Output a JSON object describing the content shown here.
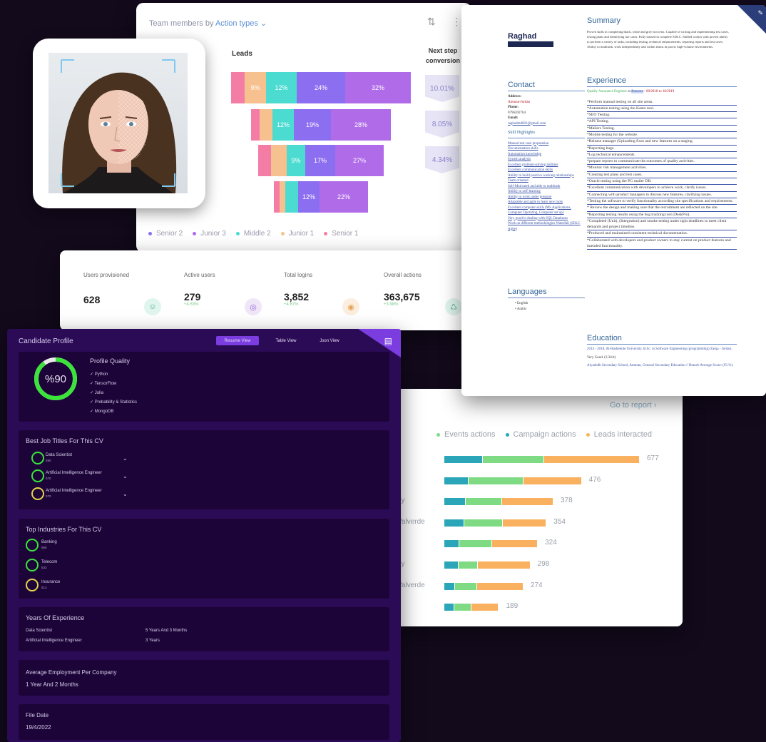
{
  "funnel": {
    "title": "Team members by",
    "title_action": "Action types",
    "leads_label": "Leads",
    "next_step_label": "Next step conversion",
    "rows": [
      {
        "segments": [
          "",
          "9%",
          "12%",
          "24%",
          "32%"
        ]
      },
      {
        "segments": [
          "",
          "",
          "12%",
          "19%",
          "28%"
        ]
      },
      {
        "segments": [
          "",
          "",
          "9%",
          "17%",
          "27%"
        ]
      },
      {
        "segments": [
          "",
          "",
          "",
          "12%",
          "22%"
        ]
      }
    ],
    "conversions": [
      "10.01%",
      "8.05%",
      "4.34%"
    ],
    "legend": [
      "Senior 2",
      "Junior 3",
      "Middle 2",
      "Junior 1",
      "Senior 1"
    ],
    "colors": {
      "senior2": "#8c6ef0",
      "junior3": "#b06be8",
      "middle2": "#4cdbd0",
      "junior1": "#f6c18f",
      "senior1": "#f47da6"
    }
  },
  "stats": {
    "items": [
      {
        "label": "Users provisioned",
        "value": "628",
        "pct": ""
      },
      {
        "label": "Active users",
        "value": "279",
        "pct": "+4.63%"
      },
      {
        "label": "Total logins",
        "value": "3,852",
        "pct": "+4.67%"
      },
      {
        "label": "Overall actions",
        "value": "363,675",
        "pct": "+3.98%"
      }
    ]
  },
  "bars": {
    "goto": "Go to report",
    "legend": [
      "Events actions",
      "Campaign actions",
      "Leads interacted"
    ],
    "colors": {
      "events": "#2aa6b8",
      "campaign": "#7fda84",
      "leads": "#f9b160"
    },
    "names": [
      "",
      "",
      "ey",
      "Valverde",
      "",
      "ey",
      "Valverde",
      ""
    ],
    "rows": [
      {
        "total": 677,
        "events": 54,
        "campaign": 86,
        "leads": 134
      },
      {
        "total": 476,
        "events": 42,
        "campaign": 94,
        "leads": 99
      },
      {
        "total": 378,
        "events": 40,
        "campaign": 68,
        "leads": 96
      },
      {
        "total": 354,
        "events": 35,
        "campaign": 66,
        "leads": 75
      },
      {
        "total": 324,
        "events": 29,
        "campaign": 65,
        "leads": 89
      },
      {
        "total": 298,
        "events": 27,
        "campaign": 37,
        "leads": 99
      },
      {
        "total": 274,
        "events": 15,
        "campaign": 32,
        "leads": 67
      },
      {
        "total": 189,
        "events": 13,
        "campaign": 22,
        "leads": 36
      }
    ]
  },
  "resume": {
    "name": "Raghad",
    "contact_title": "Contact",
    "address_label": "Address:",
    "address": "Amman-Jordan",
    "phone_label": "Phone:",
    "phone": "0796202764",
    "email_label": "Email:",
    "email": "raghadmd001@gmail.com",
    "skill_title": "Skill Highlights",
    "skills": [
      "Manual test case preparation",
      "Documentation skills",
      "Automation knowledge",
      "System analysis",
      "Excellent problem-solving abilities",
      "Excellent communication skills",
      "Ability to build positive working relationships",
      "Team oriented",
      "Self-Motivated and able to multitask",
      "Ability to self-learning",
      "Ability to work under pressure",
      "Adaptable and agile to learn new tools",
      "Excellent computer skills (MS Applications, Computer Operating, Computer set up)",
      "Very good in dealing with SQL Databases",
      "Work on different methodologies Waterfall (SDLC Agile)"
    ],
    "languages_title": "Languages",
    "languages": [
      "English",
      "Arabic"
    ],
    "summary_title": "Summary",
    "summary": "Proven skills in completing black, white and grey box tests. Capable of writing and implementing test cases, testing plans and identifying use cases. Fully trained in complete SDLC. Skilled worker with proven ability to perform a variety of tasks, including testing, technical enhancements, repairing reports and test cases. Ability to multitask, work independently and within teams in paced, high-volume environments.",
    "experience_title": "Experience",
    "experience_role": "Quality Assurance Engineer",
    "experience_at": "at",
    "experience_company": "Bonsora",
    "experience_dates": "- 09/2018 to 10/2019",
    "experience_items": [
      "*Perform manual testing on all site areas.",
      "*Automation testing using the Kanto tool.",
      "*SEO Testing.",
      "*API Testing.",
      "*Mailers Testing.",
      "*Mobile testing for the website.",
      "*Release manager (Uploading fixes and new features on a staging.",
      "*Reporting bugs.",
      "*Log technical enhancements.",
      "*prepare reports to communicate the outcomes of quality activities.",
      "*Monitor risk management activities.",
      "*Creating test plans and test cases.",
      "*Oracle testing using the PG mailer DB.",
      "*Excellent communication with developers to achieve work, clarify issues.",
      "*Connecting with product managers to discuss new features, clarifying issues.",
      "*Testing the software to verify functionality according site specifications and requirements.",
      "* Review the design and making sure that the recruitment are reflected on the site.",
      "*Reporting testing results using the bug tracking tool (DeskPro).",
      "*Completed (Unit), (Integration) and smoke testing under tight deadlines to meet client demands and project timeline.",
      "*Produced and maintained consistent technical documentation.",
      "*Collaborated with developers and product owners to stay current on product features and intended functionality."
    ],
    "education_title": "Education",
    "education_1": "2014 - 2018, Al-Hashemite University, B.Sc. in Software Engineering (programming) Zarqa - Jordan.",
    "education_2": "Very Good. (3.34/4)",
    "education_3": "Alyadodh Secondary School, Amman, General Secondary Education // Branch Average Score: (93 %)."
  },
  "candidate": {
    "title": "Candidate Profile",
    "tabs": [
      "Resume View",
      "Table View",
      "Json View"
    ],
    "quality_value": "%90",
    "quality_percent": 90,
    "quality_title": "Profile Quality",
    "quality_items": [
      "✓ Python",
      "✓ TensorFlow",
      "✓ Julia",
      "✓ Probability & Statistics",
      "✓ MongoDB"
    ],
    "jobs_title": "Best Job Titles For This CV",
    "jobs": [
      {
        "name": "Data Scientist",
        "score": "590"
      },
      {
        "name": "Artificial Intelligence Engineer",
        "score": "570"
      },
      {
        "name": "Artificial Intelligence Engineer",
        "score": "570"
      }
    ],
    "industries_title": "Top Industries For This CV",
    "industries": [
      {
        "name": "Banking",
        "score": "590"
      },
      {
        "name": "Telecom",
        "score": "532"
      },
      {
        "name": "Insurance",
        "score": "513"
      }
    ],
    "years_title": "Years Of Experience",
    "years": [
      {
        "role": "Data Scientist",
        "years": "5 Years And 3 Months"
      },
      {
        "role": "Artificial Intelligence Engineer",
        "years": "3 Years"
      }
    ],
    "avg_title": "Average Employment Per Company",
    "avg_value": "1 Year And 2 Months",
    "file_title": "File Date",
    "file_value": "19/4/2022"
  }
}
